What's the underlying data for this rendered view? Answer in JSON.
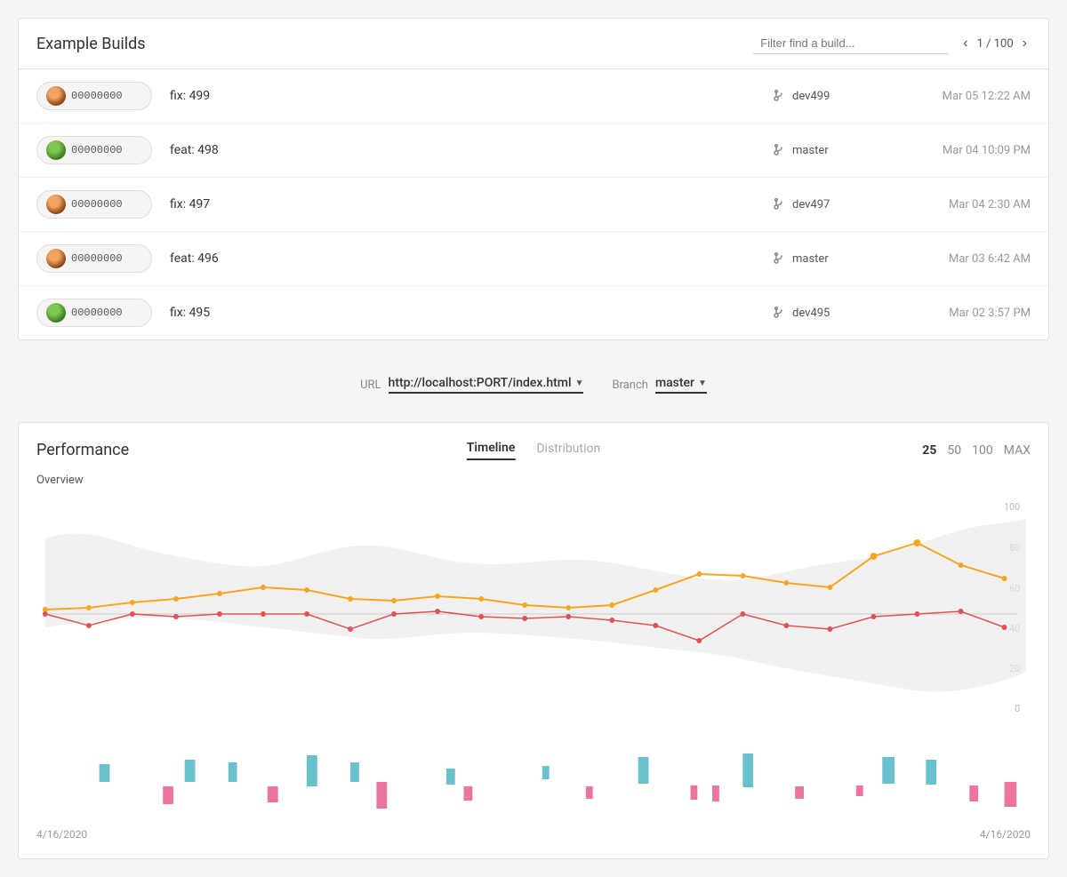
{
  "page": {
    "title": "Example Builds"
  },
  "builds_header": {
    "title": "Example Builds",
    "filter_placeholder": "Filter find a build...",
    "pagination": {
      "current": 1,
      "total": 100,
      "display": "1 / 100"
    }
  },
  "builds": [
    {
      "id": "00000000",
      "message": "fix: 499",
      "branch": "dev499",
      "time": "Mar 05 12:22 AM",
      "avatar_type": "orange"
    },
    {
      "id": "00000000",
      "message": "feat: 498",
      "branch": "master",
      "time": "Mar 04 10:09 PM",
      "avatar_type": "green"
    },
    {
      "id": "00000000",
      "message": "fix: 497",
      "branch": "dev497",
      "time": "Mar 04 2:30 AM",
      "avatar_type": "orange"
    },
    {
      "id": "00000000",
      "message": "feat: 496",
      "branch": "master",
      "time": "Mar 03 6:42 AM",
      "avatar_type": "orange"
    },
    {
      "id": "00000000",
      "message": "fix: 495",
      "branch": "dev495",
      "time": "Mar 02 3:57 PM",
      "avatar_type": "green"
    }
  ],
  "controls": {
    "url_label": "URL",
    "url_value": "http://localhost:PORT/index.html",
    "branch_label": "Branch",
    "branch_value": "master"
  },
  "performance": {
    "title": "Performance",
    "tabs": [
      {
        "label": "Timeline",
        "active": true
      },
      {
        "label": "Distribution",
        "active": false
      }
    ],
    "ranges": [
      {
        "label": "25",
        "active": true
      },
      {
        "label": "50",
        "active": false
      },
      {
        "label": "100",
        "active": false
      },
      {
        "label": "MAX",
        "active": false
      }
    ],
    "overview_label": "Overview",
    "date_start": "4/16/2020",
    "date_end": "4/16/2020",
    "y_axis_labels": [
      "100",
      "80",
      "60",
      "40",
      "20",
      "0"
    ]
  }
}
